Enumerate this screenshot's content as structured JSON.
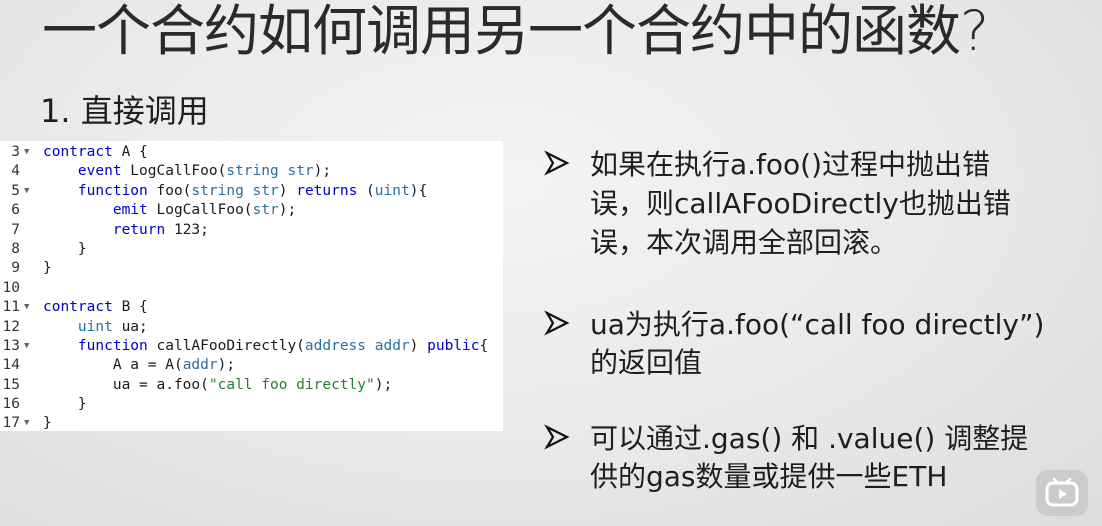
{
  "slide": {
    "title": "一个合约如何调用另一个合约中的函数?",
    "subheading": "1. 直接调用"
  },
  "code_panel": {
    "lines": [
      {
        "number": "3",
        "fold": true,
        "text": "contract A {"
      },
      {
        "number": "4",
        "fold": false,
        "text": "    event LogCallFoo(string str);"
      },
      {
        "number": "5",
        "fold": true,
        "text": "    function foo(string str) returns (uint){"
      },
      {
        "number": "6",
        "fold": false,
        "text": "        emit LogCallFoo(str);"
      },
      {
        "number": "7",
        "fold": false,
        "text": "        return 123;"
      },
      {
        "number": "8",
        "fold": false,
        "text": "    }"
      },
      {
        "number": "9",
        "fold": false,
        "text": "}"
      },
      {
        "number": "10",
        "fold": false,
        "text": ""
      },
      {
        "number": "11",
        "fold": true,
        "text": "contract B {"
      },
      {
        "number": "12",
        "fold": false,
        "text": "    uint ua;"
      },
      {
        "number": "13",
        "fold": true,
        "text": "    function callAFooDirectly(address addr) public{"
      },
      {
        "number": "14",
        "fold": false,
        "text": "        A a = A(addr);"
      },
      {
        "number": "15",
        "fold": false,
        "text": "        ua = a.foo(\"call foo directly\");"
      },
      {
        "number": "16",
        "fold": false,
        "text": "    }"
      },
      {
        "number": "17",
        "fold": true,
        "text": "}"
      }
    ]
  },
  "bullets": [
    {
      "line1": "如果在执行a.foo()过程中抛出错",
      "line2": "误，则callAFooDirectly也抛出错",
      "line3": "误，本次调用全部回滚。"
    },
    {
      "line1": "ua为执行a.foo(“call foo directly”)",
      "line2": "的返回值"
    },
    {
      "line1": "可以通过.gas() 和 .value() 调整提",
      "line2": "供的gas数量或提供一些ETH"
    }
  ],
  "icons": {
    "bullet_marker": "arrow-bullet-icon",
    "player": "play-button-icon"
  },
  "colors": {
    "keyword": "#0000c8",
    "type": "#2b6f9e",
    "string": "#2a7d2a"
  }
}
